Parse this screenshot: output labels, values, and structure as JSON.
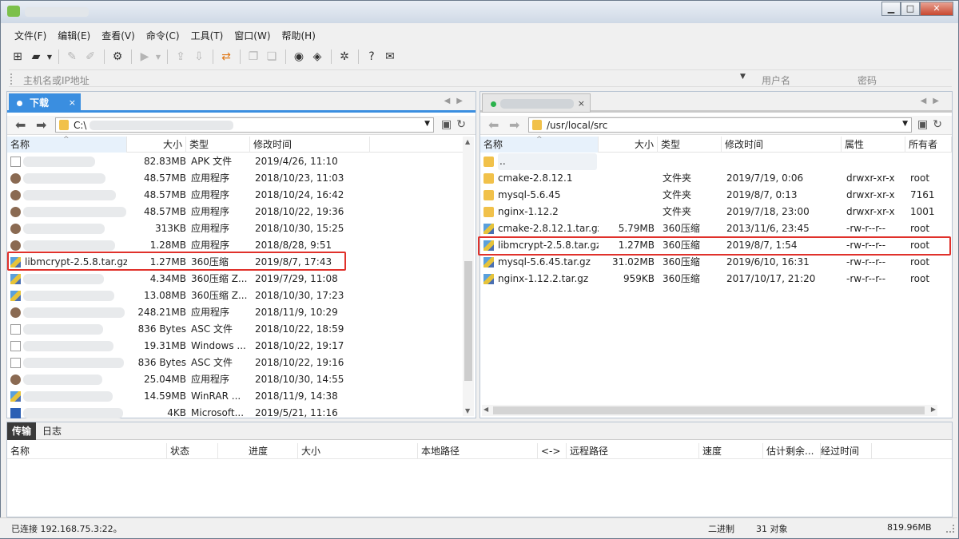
{
  "menu": [
    "文件(F)",
    "编辑(E)",
    "查看(V)",
    "命令(C)",
    "工具(T)",
    "窗口(W)",
    "帮助(H)"
  ],
  "window_controls": {
    "minimize": "▁",
    "maximize": "□",
    "close": "✕"
  },
  "host": {
    "placeholder": "主机名或IP地址",
    "username_placeholder": "用户名",
    "password_placeholder": "密码"
  },
  "left": {
    "tab_label": "下载",
    "tab_close": "×",
    "path": "C:\\",
    "columns": [
      "名称",
      "大小",
      "类型",
      "修改时间"
    ],
    "rows": [
      {
        "name": "",
        "size": "82.83MB",
        "type": "APK 文件",
        "time": "2019/4/26, 11:10",
        "icon": "file-icon"
      },
      {
        "name": "",
        "size": "48.57MB",
        "type": "应用程序",
        "time": "2018/10/23, 11:03",
        "icon": "exe-icon"
      },
      {
        "name": "",
        "size": "48.57MB",
        "type": "应用程序",
        "time": "2018/10/24, 16:42",
        "icon": "exe-icon"
      },
      {
        "name": "",
        "size": "48.57MB",
        "type": "应用程序",
        "time": "2018/10/22, 19:36",
        "icon": "exe-icon"
      },
      {
        "name": "",
        "size": "313KB",
        "type": "应用程序",
        "time": "2018/10/30, 15:25",
        "icon": "exe-icon"
      },
      {
        "name": "",
        "size": "1.28MB",
        "type": "应用程序",
        "time": "2018/8/28, 9:51",
        "icon": "exe-icon"
      },
      {
        "name": "libmcrypt-2.5.8.tar.gz",
        "size": "1.27MB",
        "type": "360压缩",
        "time": "2019/8/7, 17:43",
        "icon": "archive-icon"
      },
      {
        "name": "",
        "size": "4.34MB",
        "type": "360压缩 Z...",
        "time": "2019/7/29, 11:08",
        "icon": "archive-icon"
      },
      {
        "name": "",
        "size": "13.08MB",
        "type": "360压缩 Z...",
        "time": "2018/10/30, 17:23",
        "icon": "archive-icon"
      },
      {
        "name": "",
        "size": "248.21MB",
        "type": "应用程序",
        "time": "2018/11/9, 10:29",
        "icon": "exe-icon"
      },
      {
        "name": "",
        "size": "836 Bytes",
        "type": "ASC 文件",
        "time": "2018/10/22, 18:59",
        "icon": "file-icon"
      },
      {
        "name": "",
        "size": "19.31MB",
        "type": "Windows ...",
        "time": "2018/10/22, 19:17",
        "icon": "file-icon"
      },
      {
        "name": "",
        "size": "836 Bytes",
        "type": "ASC 文件",
        "time": "2018/10/22, 19:16",
        "icon": "file-icon"
      },
      {
        "name": "",
        "size": "25.04MB",
        "type": "应用程序",
        "time": "2018/10/30, 14:55",
        "icon": "exe-icon"
      },
      {
        "name": "",
        "size": "14.59MB",
        "type": "WinRAR ...",
        "time": "2018/11/9, 14:38",
        "icon": "archive-icon"
      },
      {
        "name": "",
        "size": "4KB",
        "type": "Microsoft...",
        "time": "2019/5/21, 11:16",
        "icon": "doc-icon"
      }
    ]
  },
  "right": {
    "path": "/usr/local/src",
    "columns": [
      "名称",
      "大小",
      "类型",
      "修改时间",
      "属性",
      "所有者"
    ],
    "rows": [
      {
        "name": "..",
        "size": "",
        "type": "",
        "time": "",
        "attr": "",
        "owner": "",
        "icon": "folder-icon"
      },
      {
        "name": "cmake-2.8.12.1",
        "size": "",
        "type": "文件夹",
        "time": "2019/7/19, 0:06",
        "attr": "drwxr-xr-x",
        "owner": "root",
        "icon": "folder-icon"
      },
      {
        "name": "mysql-5.6.45",
        "size": "",
        "type": "文件夹",
        "time": "2019/8/7, 0:13",
        "attr": "drwxr-xr-x",
        "owner": "7161",
        "icon": "folder-icon"
      },
      {
        "name": "nginx-1.12.2",
        "size": "",
        "type": "文件夹",
        "time": "2019/7/18, 23:00",
        "attr": "drwxr-xr-x",
        "owner": "1001",
        "icon": "folder-icon"
      },
      {
        "name": "cmake-2.8.12.1.tar.gz",
        "size": "5.79MB",
        "type": "360压缩",
        "time": "2013/11/6, 23:45",
        "attr": "-rw-r--r--",
        "owner": "root",
        "icon": "archive-icon"
      },
      {
        "name": "libmcrypt-2.5.8.tar.gz",
        "size": "1.27MB",
        "type": "360压缩",
        "time": "2019/8/7, 1:54",
        "attr": "-rw-r--r--",
        "owner": "root",
        "icon": "archive-icon"
      },
      {
        "name": "mysql-5.6.45.tar.gz",
        "size": "31.02MB",
        "type": "360压缩",
        "time": "2019/6/10, 16:31",
        "attr": "-rw-r--r--",
        "owner": "root",
        "icon": "archive-icon"
      },
      {
        "name": "nginx-1.12.2.tar.gz",
        "size": "959KB",
        "type": "360压缩",
        "time": "2017/10/17, 21:20",
        "attr": "-rw-r--r--",
        "owner": "root",
        "icon": "archive-icon"
      }
    ]
  },
  "bottom": {
    "tabs": [
      "传输",
      "日志"
    ],
    "columns": [
      "名称",
      "状态",
      "进度",
      "大小",
      "本地路径",
      "<->",
      "远程路径",
      "速度",
      "估计剩余...",
      "经过时间"
    ]
  },
  "status": {
    "connection": "已连接 192.168.75.3:22。",
    "mode": "二进制",
    "objects": "31 对象",
    "size": "819.96MB"
  },
  "colors": {
    "accent": "#3a8ee0",
    "highlight": "#e0312b"
  }
}
